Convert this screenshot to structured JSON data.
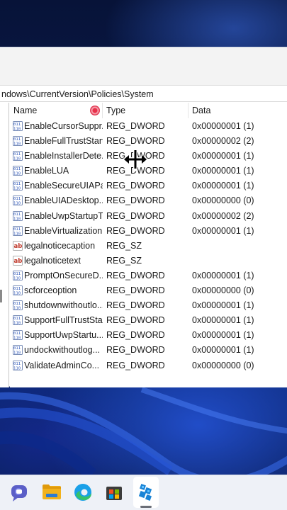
{
  "address_bar": {
    "path": "ndows\\CurrentVersion\\Policies\\System"
  },
  "columns": {
    "name": "Name",
    "type": "Type",
    "data": "Data"
  },
  "rows": [
    {
      "icon": "dword-icon",
      "name": "EnableCursorSuppr...",
      "type": "REG_DWORD",
      "data": "0x00000001 (1)"
    },
    {
      "icon": "dword-icon",
      "name": "EnableFullTrustStart...",
      "type": "REG_DWORD",
      "data": "0x00000002 (2)"
    },
    {
      "icon": "dword-icon",
      "name": "EnableInstallerDete...",
      "type": "REG_DWORD",
      "data": "0x00000001 (1)"
    },
    {
      "icon": "dword-icon",
      "name": "EnableLUA",
      "type": "REG_DWORD",
      "data": "0x00000001 (1)"
    },
    {
      "icon": "dword-icon",
      "name": "EnableSecureUIAPa...",
      "type": "REG_DWORD",
      "data": "0x00000001 (1)"
    },
    {
      "icon": "dword-icon",
      "name": "EnableUIADesktop...",
      "type": "REG_DWORD",
      "data": "0x00000000 (0)"
    },
    {
      "icon": "dword-icon",
      "name": "EnableUwpStartupT...",
      "type": "REG_DWORD",
      "data": "0x00000002 (2)"
    },
    {
      "icon": "dword-icon",
      "name": "EnableVirtualization",
      "type": "REG_DWORD",
      "data": "0x00000001 (1)"
    },
    {
      "icon": "string-icon",
      "name": "legalnoticecaption",
      "type": "REG_SZ",
      "data": ""
    },
    {
      "icon": "string-icon",
      "name": "legalnoticetext",
      "type": "REG_SZ",
      "data": ""
    },
    {
      "icon": "dword-icon",
      "name": "PromptOnSecureD...",
      "type": "REG_DWORD",
      "data": "0x00000001 (1)"
    },
    {
      "icon": "dword-icon",
      "name": "scforceoption",
      "type": "REG_DWORD",
      "data": "0x00000000 (0)"
    },
    {
      "icon": "dword-icon",
      "name": "shutdownwithoutlo...",
      "type": "REG_DWORD",
      "data": "0x00000001 (1)"
    },
    {
      "icon": "dword-icon",
      "name": "SupportFullTrustSta...",
      "type": "REG_DWORD",
      "data": "0x00000001 (1)"
    },
    {
      "icon": "dword-icon",
      "name": "SupportUwpStartu...",
      "type": "REG_DWORD",
      "data": "0x00000001 (1)"
    },
    {
      "icon": "dword-icon",
      "name": "undockwithoutlog...",
      "type": "REG_DWORD",
      "data": "0x00000001 (1)"
    },
    {
      "icon": "dword-icon",
      "name": "ValidateAdminCo...",
      "type": "REG_DWORD",
      "data": "0x00000000 (0)"
    }
  ],
  "taskbar": {
    "items": [
      {
        "name": "teams-chat-icon"
      },
      {
        "name": "file-explorer-icon"
      },
      {
        "name": "edge-browser-icon"
      },
      {
        "name": "microsoft-store-icon"
      },
      {
        "name": "registry-editor-icon",
        "active": true
      }
    ]
  },
  "colors": {
    "accent": "#0067c0",
    "wallpaper": "#0b1d55",
    "taskbar": "#eef1f7"
  }
}
